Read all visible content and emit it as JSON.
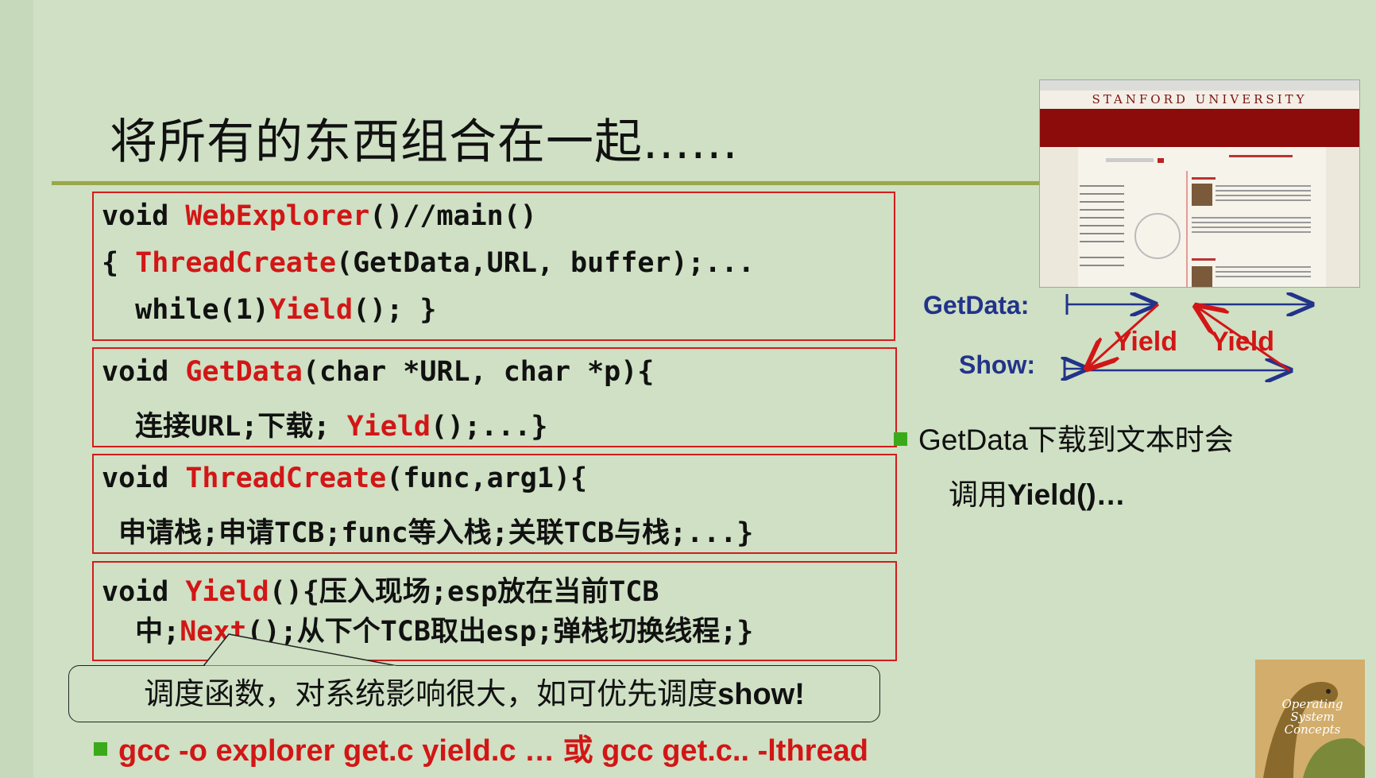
{
  "slide": {
    "title": "将所有的东西组合在一起......"
  },
  "code_blocks": {
    "web_explorer": {
      "l1_a": "void ",
      "l1_b": "WebExplorer",
      "l1_c": "()//main()",
      "l2_a": "{ ",
      "l2_b": "ThreadCreate",
      "l2_c": "(GetData,URL, buffer);...",
      "l3_a": "  while(1)",
      "l3_b": "Yield",
      "l3_c": "(); }"
    },
    "get_data": {
      "l1_a": "void ",
      "l1_b": "GetData",
      "l1_c": "(char *URL, char *p){",
      "l2_a": "  连接URL;下载; ",
      "l2_b": "Yield",
      "l2_c": "();...}"
    },
    "thread_create": {
      "l1_a": "void ",
      "l1_b": "ThreadCreate",
      "l1_c": "(func,arg1){",
      "l2": " 申请栈;申请TCB;func等入栈;关联TCB与栈;...}"
    },
    "yield": {
      "l1_a": "void ",
      "l1_b": "Yield",
      "l1_c": "(){压入现场;esp放在当前TCB",
      "l2_a": "  中;",
      "l2_b": "Next",
      "l2_c": "();从下个TCB取出esp;弹栈切换线程;}"
    }
  },
  "callout": {
    "text_a": "调度函数，对系统影响很大，如可优先调度",
    "text_b": "show!"
  },
  "bottom_bullet": "gcc -o explorer get.c yield.c … 或 gcc get.c.. -lthread",
  "diagram": {
    "getdata_label": "GetData:",
    "show_label": "Show:",
    "yield_label_1": "Yield",
    "yield_label_2": "Yield"
  },
  "right_bullet": {
    "line1": "GetData下载到文本时会",
    "line2_a": "调用",
    "line2_b": "Yield()…"
  },
  "stanford_screenshot": {
    "header": "STANFORD UNIVERSITY"
  },
  "book_cover": {
    "title": "Operating System Concepts"
  },
  "colors": {
    "background": "#cfe0c4",
    "accent_red": "#d21616",
    "diagram_blue": "#22338a",
    "bullet_green": "#3aaa1a",
    "rule_olive": "#9aa84a"
  }
}
